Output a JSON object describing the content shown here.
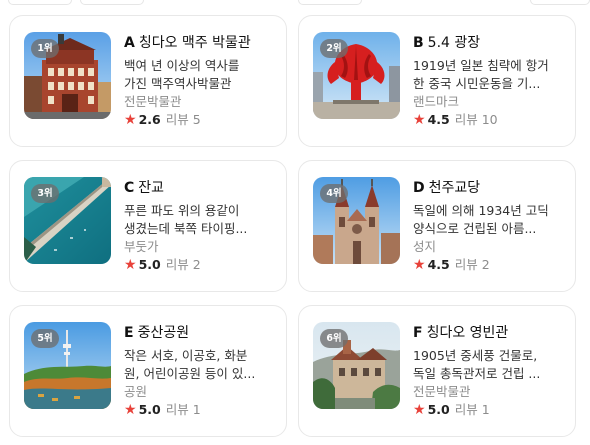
{
  "places": [
    {
      "rank": "1위",
      "letter": "A",
      "name": "칭다오 맥주 박물관",
      "desc_lines": [
        "백여 년 이상의 역사를",
        "가진 맥주역사박물관"
      ],
      "category": "전문박물관",
      "score": "2.6",
      "review_label": "리뷰",
      "review_count": "5",
      "thumb_icon": "beer-museum-photo"
    },
    {
      "rank": "2위",
      "letter": "B",
      "name": "5.4 광장",
      "desc_lines": [
        "1919년 일본 침략에 항거",
        "한 중국 시민운동을 기..."
      ],
      "category": "랜드마크",
      "score": "4.5",
      "review_label": "리뷰",
      "review_count": "10",
      "thumb_icon": "may-fourth-square-photo"
    },
    {
      "rank": "3위",
      "letter": "C",
      "name": "잔교",
      "desc_lines": [
        "푸른 파도 위의 용같이",
        "생겼는데 북쪽 타이핑..."
      ],
      "category": "부둣가",
      "score": "5.0",
      "review_label": "리뷰",
      "review_count": "2",
      "thumb_icon": "pier-photo"
    },
    {
      "rank": "4위",
      "letter": "D",
      "name": "천주교당",
      "desc_lines": [
        "독일에 의해 1934년 고딕",
        "양식으로 건립된 아름..."
      ],
      "category": "성지",
      "score": "4.5",
      "review_label": "리뷰",
      "review_count": "2",
      "thumb_icon": "cathedral-photo"
    },
    {
      "rank": "5위",
      "letter": "E",
      "name": "중산공원",
      "desc_lines": [
        "작은 서호, 이공호, 화분",
        "원, 어린이공원 등이 있..."
      ],
      "category": "공원",
      "score": "5.0",
      "review_label": "리뷰",
      "review_count": "1",
      "thumb_icon": "park-tower-photo"
    },
    {
      "rank": "6위",
      "letter": "F",
      "name": "칭다오 영빈관",
      "desc_lines": [
        "1905년 중세풍 건물로,",
        "독일 총독관저로 건립 ..."
      ],
      "category": "전문박물관",
      "score": "5.0",
      "review_label": "리뷰",
      "review_count": "1",
      "thumb_icon": "guesthouse-photo"
    }
  ],
  "colors": {
    "star": "#e8423a",
    "border": "#e8e8e8",
    "rank_badge": "#6e6e6e"
  }
}
